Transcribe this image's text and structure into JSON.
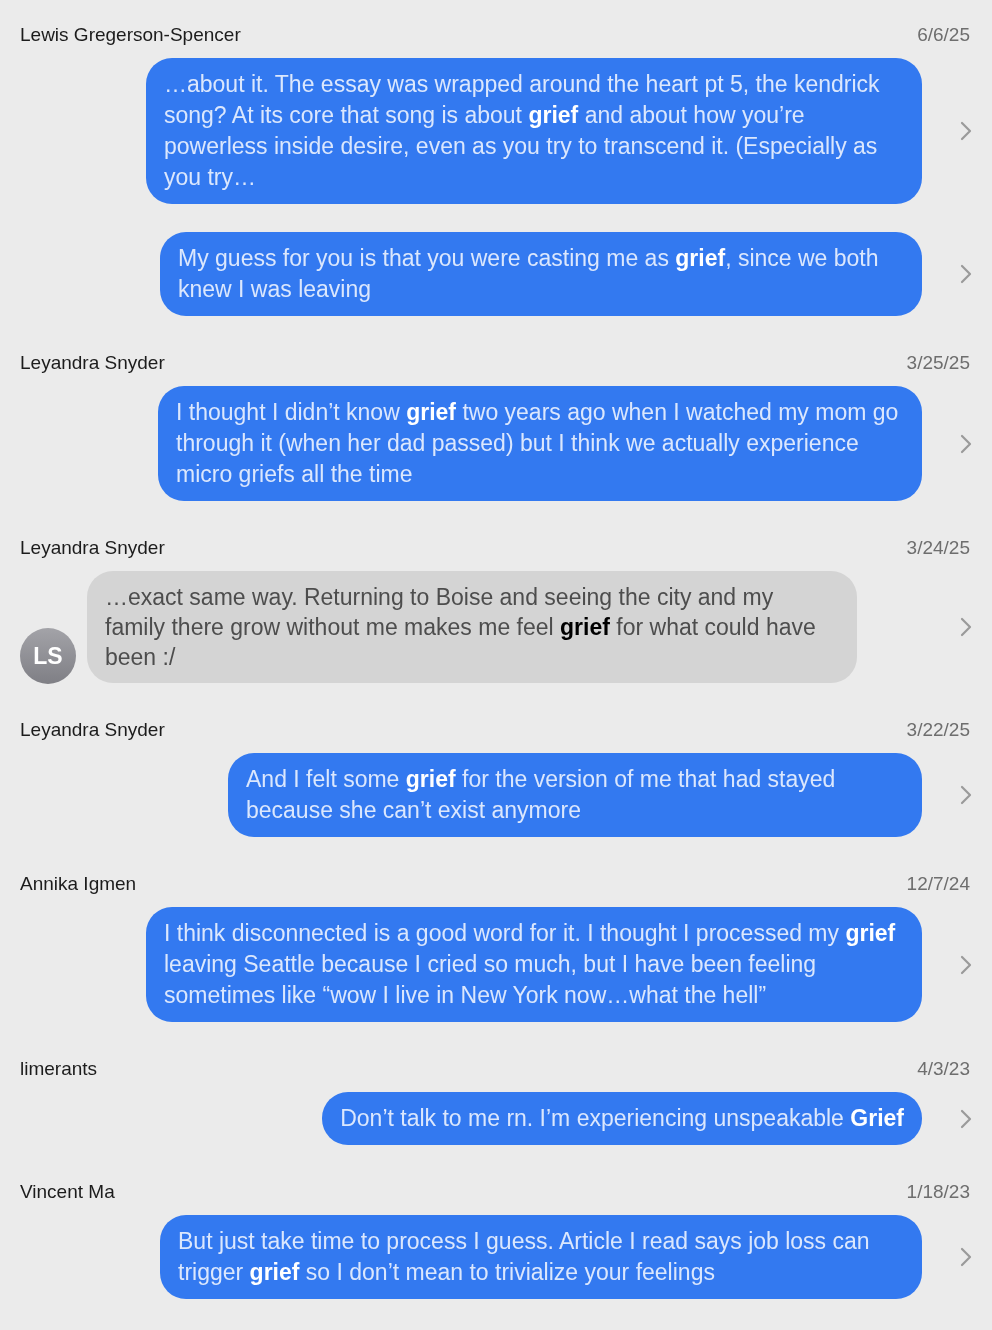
{
  "results": [
    {
      "sender": "Lewis Gregerson-Spencer",
      "date": "6/6/25",
      "messages": [
        {
          "kind": "outgoing",
          "text": "…about it. The essay was wrapped around the heart pt 5, the kendrick song? At its core that song is about **grief** and about how you’re powerless inside desire, even as you try to transcend it. (Especially as you try…"
        },
        {
          "kind": "outgoing",
          "text": "My guess for you is that you were casting me as **grief**, since we both knew I was leaving"
        }
      ]
    },
    {
      "sender": "Leyandra Snyder",
      "date": "3/25/25",
      "messages": [
        {
          "kind": "outgoing",
          "text": "I thought I didn’t know **grief** two years ago when I watched my mom go through it (when her dad passed) but I think we actually experience micro griefs all the time"
        }
      ]
    },
    {
      "sender": "Leyandra Snyder",
      "date": "3/24/25",
      "messages": [
        {
          "kind": "incoming",
          "avatar": "LS",
          "text": "…exact same way. Returning to Boise and seeing the city and my family there grow without me makes me feel **grief** for what could have been :/"
        }
      ]
    },
    {
      "sender": "Leyandra Snyder",
      "date": "3/22/25",
      "messages": [
        {
          "kind": "outgoing",
          "text": "And I felt some **grief** for the version of me that had stayed because she can’t exist anymore"
        }
      ]
    },
    {
      "sender": "Annika Igmen",
      "date": "12/7/24",
      "messages": [
        {
          "kind": "outgoing",
          "text": "I think disconnected is a good word for it. I thought I processed my **grief** leaving Seattle because I cried so much, but I have been feeling sometimes like “wow I live in New York now…what the hell”"
        }
      ]
    },
    {
      "sender": "limerants",
      "date": "4/3/23",
      "messages": [
        {
          "kind": "outgoing",
          "text": "Don’t talk to me rn. I’m experiencing unspeakable **Grief**"
        }
      ]
    },
    {
      "sender": "Vincent Ma",
      "date": "1/18/23",
      "messages": [
        {
          "kind": "outgoing",
          "text": "But just take time to process I guess. Article I read says job loss can trigger **grief** so I don’t mean to trivialize your feelings"
        }
      ]
    }
  ]
}
